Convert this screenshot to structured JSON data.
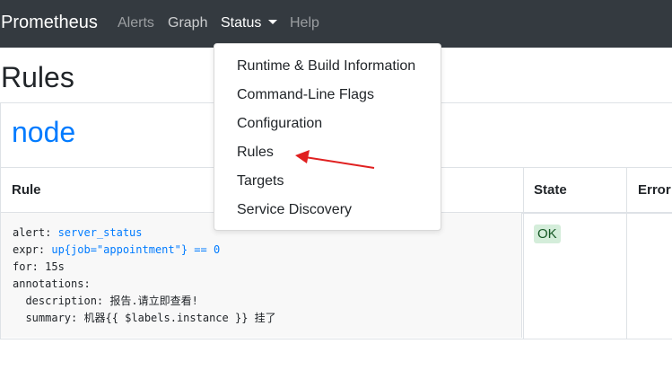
{
  "navbar": {
    "brand": "Prometheus",
    "items": [
      "Alerts",
      "Graph",
      "Status",
      "Help"
    ]
  },
  "page": {
    "title": "Rules"
  },
  "rule_group": {
    "name": "node",
    "columns": [
      "Rule",
      "State",
      "Error"
    ],
    "rule": {
      "alert_key": "alert: ",
      "alert_value": "server_status",
      "expr_key": "expr: ",
      "expr_value": "up{job=\"appointment\"} == 0",
      "for_line": "for: 15s",
      "annotations_line": "annotations:",
      "description_line": "  description: 报告.请立即查看!",
      "summary_line": "  summary: 机器{{ $labels.instance }} 挂了"
    },
    "state": "OK"
  },
  "status_menu": {
    "items": [
      "Runtime & Build Information",
      "Command-Line Flags",
      "Configuration",
      "Rules",
      "Targets",
      "Service Discovery"
    ]
  },
  "colors": {
    "navbar": "#343a40",
    "link": "#007bff",
    "ok_badge": "#d4edda",
    "arrow": "#e02020"
  }
}
